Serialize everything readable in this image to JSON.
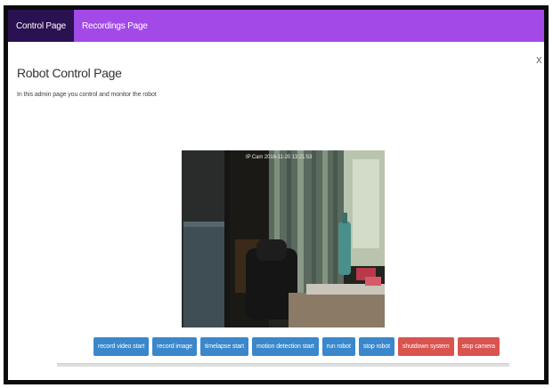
{
  "nav": {
    "tabs": [
      {
        "label": "Control Page",
        "active": true
      },
      {
        "label": "Recordings Page",
        "active": false
      }
    ]
  },
  "page": {
    "title": "Robot Control Page",
    "description": "In this admin page you control and monitor the robot",
    "close_label": "X"
  },
  "camera": {
    "timestamp": "IP Cam 2016-11-20 13:21:53"
  },
  "controls": {
    "buttons": [
      {
        "label": "record video start",
        "style": "primary"
      },
      {
        "label": "record image",
        "style": "primary"
      },
      {
        "label": "timelapse start",
        "style": "primary"
      },
      {
        "label": "motion detection start",
        "style": "primary"
      },
      {
        "label": "run robot",
        "style": "primary"
      },
      {
        "label": "stop robot",
        "style": "primary"
      },
      {
        "label": "shutdown system",
        "style": "danger"
      },
      {
        "label": "stop camera",
        "style": "danger"
      }
    ]
  },
  "colors": {
    "navbar": "#a349e8",
    "active_tab": "#2a1151",
    "primary_button": "#3a87cb",
    "danger_button": "#d9534f"
  }
}
